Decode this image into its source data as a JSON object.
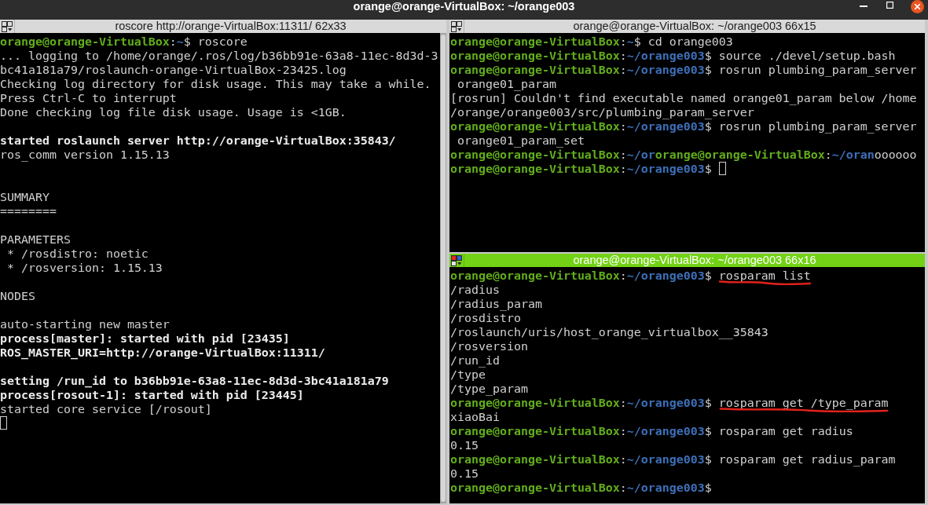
{
  "window": {
    "title": "orange@orange-VirtualBox: ~/orange003"
  },
  "left_pane": {
    "title": "roscore http://orange-VirtualBox:11311/ 62x33",
    "active": false,
    "scrollbar": true,
    "cursor": true,
    "lines": [
      {
        "kind": "prompt",
        "host": "orange@orange-VirtualBox",
        "colon": ":",
        "cwd": "~",
        "sign": "$",
        "command": "roscore",
        "underlined": false
      },
      {
        "kind": "output",
        "text": "... logging to /home/orange/.ros/log/b36bb91e-63a8-11ec-8d3d-3bc41a181a79/roslaunch-orange-VirtualBox-23425.log"
      },
      {
        "kind": "output",
        "text": "Checking log directory for disk usage. This may take a while."
      },
      {
        "kind": "output",
        "text": "Press Ctrl-C to interrupt"
      },
      {
        "kind": "output",
        "text": "Done checking log file disk usage. Usage is <1GB."
      },
      {
        "kind": "blank"
      },
      {
        "kind": "bold",
        "text": "started roslaunch server http://orange-VirtualBox:35843/"
      },
      {
        "kind": "output",
        "text": "ros_comm version 1.15.13"
      },
      {
        "kind": "blank"
      },
      {
        "kind": "blank"
      },
      {
        "kind": "output",
        "text": "SUMMARY"
      },
      {
        "kind": "output",
        "text": "========"
      },
      {
        "kind": "blank"
      },
      {
        "kind": "output",
        "text": "PARAMETERS"
      },
      {
        "kind": "output",
        "text": " * /rosdistro: noetic"
      },
      {
        "kind": "output",
        "text": " * /rosversion: 1.15.13"
      },
      {
        "kind": "blank"
      },
      {
        "kind": "output",
        "text": "NODES"
      },
      {
        "kind": "blank"
      },
      {
        "kind": "output",
        "text": "auto-starting new master"
      },
      {
        "kind": "bold",
        "text": "process[master]: started with pid [23435]"
      },
      {
        "kind": "bold",
        "text": "ROS_MASTER_URI=http://orange-VirtualBox:11311/"
      },
      {
        "kind": "blank"
      },
      {
        "kind": "bold",
        "text": "setting /run_id to b36bb91e-63a8-11ec-8d3d-3bc41a181a79"
      },
      {
        "kind": "bold",
        "text": "process[rosout-1]: started with pid [23445]"
      },
      {
        "kind": "output",
        "text": "started core service [/rosout]"
      },
      {
        "kind": "blank"
      }
    ]
  },
  "right_panes": [
    {
      "title": "orange@orange-VirtualBox: ~/orange003 66x15",
      "active": false,
      "scrollbar": false,
      "cursor": true,
      "lines": [
        {
          "kind": "prompt",
          "host": "orange@orange-VirtualBox",
          "colon": ":",
          "cwd": "~",
          "sign": "$",
          "command": "cd orange003",
          "underlined": false
        },
        {
          "kind": "prompt",
          "host": "orange@orange-VirtualBox",
          "colon": ":",
          "cwd": "~/orange003",
          "sign": "$",
          "command": "source ./devel/setup.bash",
          "underlined": false
        },
        {
          "kind": "prompt",
          "host": "orange@orange-VirtualBox",
          "colon": ":",
          "cwd": "~/orange003",
          "sign": "$",
          "command": "rosrun plumbing_param_server orange01_param",
          "underlined": false
        },
        {
          "kind": "output",
          "text": "[rosrun] Couldn't find executable named orange01_param below /home/orange/orange003/src/plumbing_param_server"
        },
        {
          "kind": "prompt",
          "host": "orange@orange-VirtualBox",
          "colon": ":",
          "cwd": "~/orange003",
          "sign": "$",
          "command": "rosrun plumbing_param_server orange01_param_set",
          "underlined": false
        },
        {
          "kind": "mixed",
          "segments": [
            {
              "kind": "host",
              "text": "orange@orange-VirtualBox"
            },
            {
              "kind": "plain",
              "text": ":"
            },
            {
              "kind": "path",
              "text": "~/or"
            },
            {
              "kind": "host",
              "text": "orange@orange-VirtualBox"
            },
            {
              "kind": "plain",
              "text": ":"
            },
            {
              "kind": "path",
              "text": "~/oran"
            },
            {
              "kind": "plain",
              "text": "oooooo"
            }
          ]
        },
        {
          "kind": "prompt",
          "host": "orange@orange-VirtualBox",
          "colon": ":",
          "cwd": "~/orange003",
          "sign": "$"
        }
      ]
    },
    {
      "title": "orange@orange-VirtualBox: ~/orange003 66x16",
      "active": true,
      "scrollbar": false,
      "cursor": false,
      "lines": [
        {
          "kind": "prompt",
          "host": "orange@orange-VirtualBox",
          "colon": ":",
          "cwd": "~/orange003",
          "sign": "$",
          "command": "rosparam list",
          "underlined": true
        },
        {
          "kind": "output",
          "text": "/radius"
        },
        {
          "kind": "output",
          "text": "/radius_param"
        },
        {
          "kind": "output",
          "text": "/rosdistro"
        },
        {
          "kind": "output",
          "text": "/roslaunch/uris/host_orange_virtualbox__35843"
        },
        {
          "kind": "output",
          "text": "/rosversion"
        },
        {
          "kind": "output",
          "text": "/run_id"
        },
        {
          "kind": "output",
          "text": "/type"
        },
        {
          "kind": "output",
          "text": "/type_param"
        },
        {
          "kind": "prompt",
          "host": "orange@orange-VirtualBox",
          "colon": ":",
          "cwd": "~/orange003",
          "sign": "$",
          "command": "rosparam get /type_param",
          "underlined": true
        },
        {
          "kind": "output",
          "text": "xiaoBai"
        },
        {
          "kind": "prompt",
          "host": "orange@orange-VirtualBox",
          "colon": ":",
          "cwd": "~/orange003",
          "sign": "$",
          "command": "rosparam get radius",
          "underlined": false
        },
        {
          "kind": "output",
          "text": "0.15"
        },
        {
          "kind": "prompt",
          "host": "orange@orange-VirtualBox",
          "colon": ":",
          "cwd": "~/orange003",
          "sign": "$",
          "command": "rosparam get radius_param",
          "underlined": false
        },
        {
          "kind": "output",
          "text": "0.15"
        },
        {
          "kind": "prompt",
          "host": "orange@orange-VirtualBox",
          "colon": ":",
          "cwd": "~/orange003",
          "sign": "$"
        }
      ]
    }
  ]
}
